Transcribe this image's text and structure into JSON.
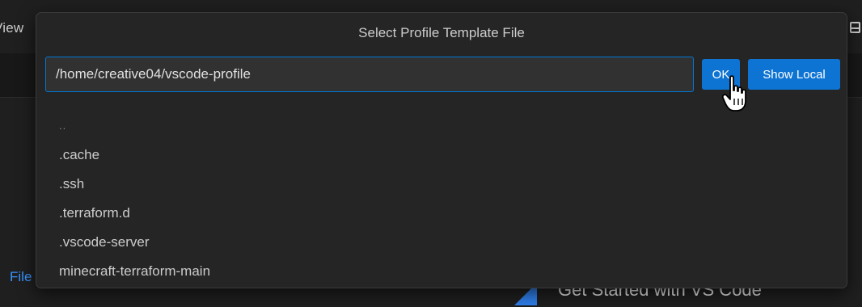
{
  "background": {
    "menu_view": "View",
    "file_link": "File",
    "walkthrough_title": "Get Started with VS Code"
  },
  "dialog": {
    "title": "Select Profile Template File",
    "path_value": "/home/creative04/vscode-profile",
    "ok_label": "OK",
    "show_local_label": "Show Local",
    "items": [
      {
        "label": ".."
      },
      {
        "label": ".cache"
      },
      {
        "label": ".ssh"
      },
      {
        "label": ".terraform.d"
      },
      {
        "label": ".vscode-server"
      },
      {
        "label": "minecraft-terraform-main"
      }
    ]
  },
  "colors": {
    "accent": "#0e74d3",
    "focus_border": "#0078d4",
    "dialog_bg": "#252526",
    "link": "#3794ff"
  },
  "icons": {
    "cursor": "hand-pointer-icon",
    "layout": "layout-panel-icon",
    "walkthrough": "walkthrough-icon"
  }
}
